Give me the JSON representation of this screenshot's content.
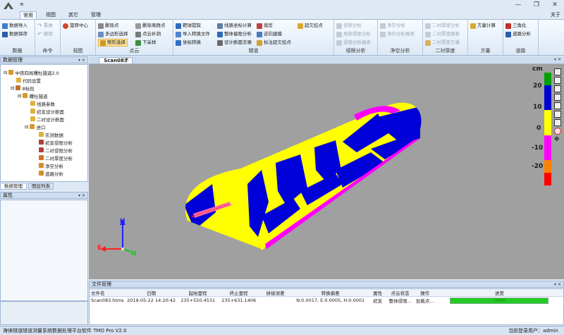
{
  "titlebar": {
    "qat": "≡"
  },
  "window": {
    "min": "—",
    "restore": "❐",
    "close": "✕"
  },
  "ribbon_tabs": [
    {
      "label": "常用"
    },
    {
      "label": "视图"
    },
    {
      "label": "其它"
    },
    {
      "label": "管理"
    }
  ],
  "about": "关于",
  "groups": {
    "data": {
      "label": "数据",
      "import": "数据导入",
      "save": "数据保存"
    },
    "cmd": {
      "label": "命令",
      "undo": "撤销",
      "redo": "重做"
    },
    "view": {
      "label": "视图",
      "rotate_center": "旋转中心"
    },
    "pointcloud": {
      "label": "点云",
      "delete_points": "删除点",
      "polygon_select": "多边形选择",
      "rect_select": "矩形选择",
      "delete_outliers": "删除离群点",
      "fill_holes": "点云补洞",
      "downsample": "下采样"
    },
    "tunnel": {
      "label": "隧道",
      "target_extract": "靶球提取",
      "import_convert": "导入转换文件",
      "coord_convert": "坐标转换",
      "line_coord_calc": "线路坐标计算",
      "overall_deviation": "整体偏限分析",
      "design_section": "设计断面去噪",
      "cut": "裁剪",
      "reverse_model": "逆向建模",
      "mark_over_under": "标注超欠挖点",
      "over_under_points": "超欠挖点"
    },
    "deviation": {
      "label": "侵限分析",
      "analysis": "侵限分析",
      "local": "局部侵限分析",
      "report": "侵限分析报表"
    },
    "clearance": {
      "label": "净空分析",
      "analysis": "净空分析",
      "report": "净空分析报表"
    },
    "lining": {
      "label": "二衬厚度",
      "analysis": "二衬厚度分析",
      "report": "二衬厚度报表",
      "scheme": "二衬厚度方量"
    },
    "volume": {
      "label": "方量",
      "calc": "方量计算"
    },
    "road": {
      "label": "道路",
      "triangulate": "三角化",
      "road_analysis": "道路分析"
    }
  },
  "left_panel": {
    "title": "数据管理",
    "tree": [
      {
        "label": "中铁四局曙杜隧道2.0"
      },
      {
        "label": "代码设置"
      },
      {
        "label": "8标段"
      },
      {
        "label": "曙杜隧道"
      },
      {
        "label": "线路参数"
      },
      {
        "label": "初支设计断面"
      },
      {
        "label": "二衬设计断面"
      },
      {
        "label": "进口"
      },
      {
        "label": "实测数据"
      },
      {
        "label": "初支侵限分析"
      },
      {
        "label": "二衬侵限分析"
      },
      {
        "label": "二衬厚度分析"
      },
      {
        "label": "净空分析"
      },
      {
        "label": "道路分析"
      }
    ],
    "tabs": [
      {
        "label": "数据管理"
      },
      {
        "label": "图层列表"
      }
    ],
    "props_title": "属性"
  },
  "viewport": {
    "tab": "Scan083",
    "colorbar": {
      "unit": "cm",
      "ticks": [
        "20",
        "10",
        "0",
        "-10",
        "-20"
      ],
      "colors": [
        "#00a000",
        "#0000d0",
        "#0000d0",
        "#ffff00",
        "#ffff00",
        "#ff00ff",
        "#ff00ff",
        "#ff8000",
        "#ff0000"
      ]
    },
    "axes": {
      "h": "H",
      "e": "E",
      "n": "N"
    }
  },
  "file_panel": {
    "title": "文件管理",
    "columns": [
      "文件名",
      "日期",
      "起始里程",
      "终止里程",
      "拼接误差",
      "转换偏差",
      "属性",
      "点云状态",
      "操作",
      "进度"
    ],
    "rows": [
      {
        "name": "Scan083.htms",
        "date": "2019-05-22 14:20:42",
        "start": "235+550.4531",
        "end": "235+631.1406",
        "stitch": "",
        "conv": "N:0.0017, E:0.0005, H:0.0001",
        "attr": "初支",
        "status": "整体侵限...",
        "op": "加载点...",
        "progress_text": "100%",
        "progress": 1.0
      }
    ]
  },
  "status": {
    "left": "海徕隧道隧道测量系统数据处理平台软件  TMO Pro V2.0",
    "right": "当前登录用户：admin"
  }
}
